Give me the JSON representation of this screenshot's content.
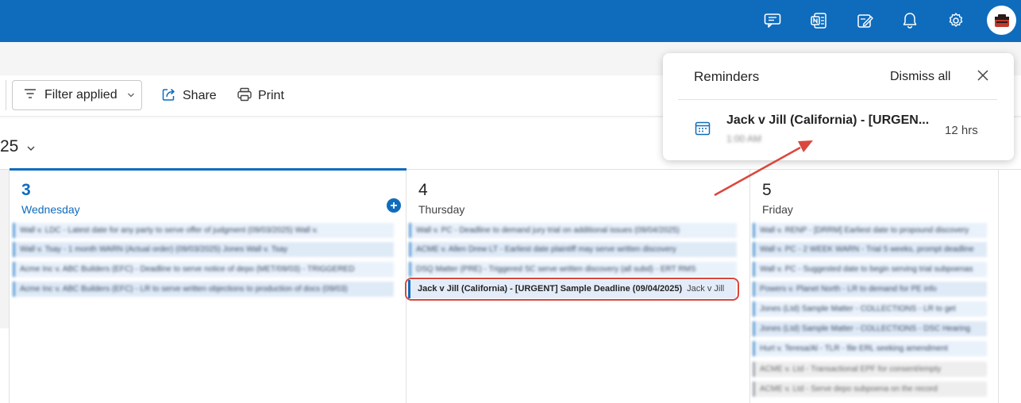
{
  "colors": {
    "brand": "#0f6cbd",
    "annotation": "#d9473d",
    "event_bg": "#e3ecf8"
  },
  "topbar": {
    "icons": [
      "feedback-icon",
      "onenote-icon",
      "tasks-icon",
      "bell-icon",
      "gear-icon",
      "avatar"
    ]
  },
  "toolbar": {
    "filter_label": "Filter applied",
    "share_label": "Share",
    "print_label": "Print"
  },
  "date_header": {
    "partial_year": "25"
  },
  "days": [
    {
      "number": "3",
      "name": "Wednesday",
      "today": true
    },
    {
      "number": "4",
      "name": "Thursday",
      "today": false
    },
    {
      "number": "5",
      "name": "Friday",
      "today": false
    }
  ],
  "events": {
    "wednesday": [
      "Wall v. LDC - Latest date for any party to serve offer of judgment (09/03/2025) Wall v.",
      "Wall v. Tsay - 1 month WARN (Actual order) (09/03/2025) Jones Wall v. Tsay",
      "Acme Inc v. ABC Builders (EFC) - Deadline to serve notice of depo (MET/09/03) - TRIGGERED",
      "Acme Inc v. ABC Builders (EFC) - LR to serve written objections to production of docs (09/03)"
    ],
    "thursday_blurred": [
      "Wall v. PC - Deadline to demand jury trial on additional issues (09/04/2025)",
      "ACME v. Allen Drew LT - Earliest date plaintiff may serve written discovery",
      "DSQ Matter (PRE) - Triggered SC serve written discovery (all subd) - ERT RMS"
    ],
    "thursday_focus": {
      "title": "Jack v Jill (California) - [URGENT] Sample Deadline (09/04/2025)",
      "owner": "Jack v Jill"
    },
    "friday": [
      "Wall v. RENP - [DRRM] Earliest date to propound discovery",
      "Wall v. PC - 2 WEEK WARN - Trial 5 weeks, prompt deadline",
      "Wall v. PC - Suggested date to begin serving trial subpoenas",
      "Powers v. Planet North - LR to demand for PE info",
      "Jones (Ltd) Sample Matter - COLLECTIONS - LR to get",
      "Jones (Ltd) Sample Matter - COLLECTIONS - DSC Hearing",
      "Hurt v. Teresa/Al - TLR - file ERL seeking amendment",
      "ACME v. Ltd - Transactional EPF for consent/empty",
      "ACME v. Ltd - Serve depo subpoena on the record"
    ]
  },
  "reminders": {
    "title": "Reminders",
    "dismiss_all": "Dismiss all",
    "items": [
      {
        "event": "Jack v Jill (California) - [URGEN...",
        "time_blurred": "1:00 AM",
        "due": "12 hrs"
      }
    ]
  }
}
